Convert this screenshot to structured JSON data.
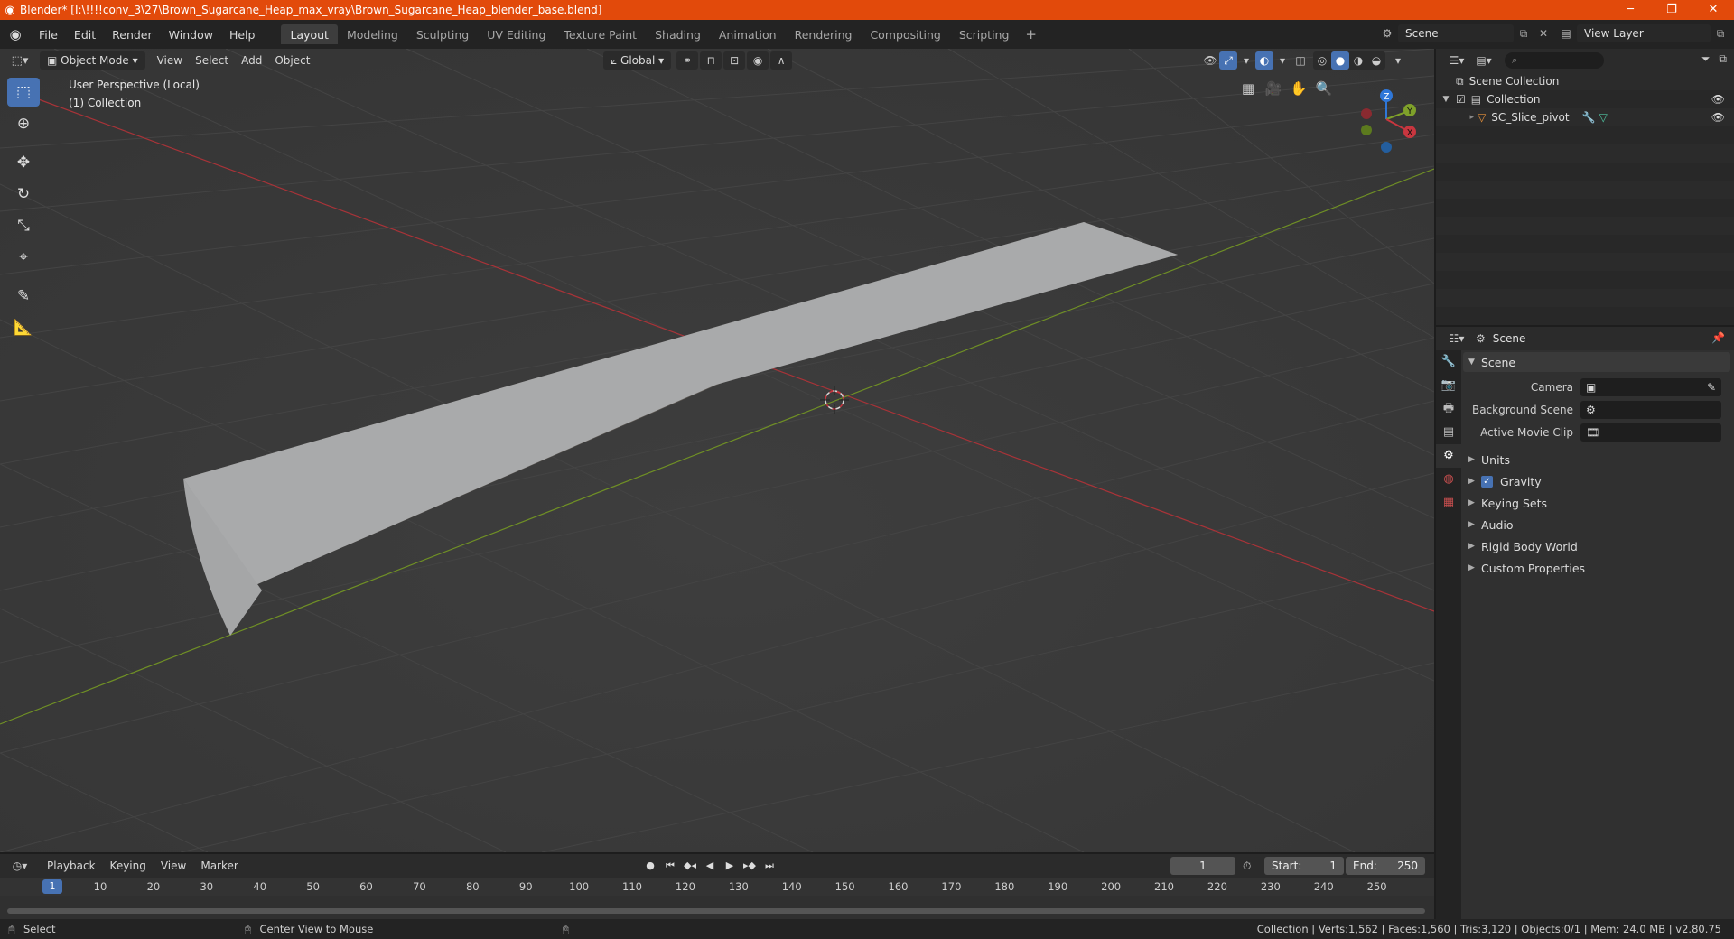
{
  "window": {
    "title": "Blender* [I:\\!!!!conv_3\\27\\Brown_Sugarcane_Heap_max_vray\\Brown_Sugarcane_Heap_blender_base.blend]",
    "minimize_icon": "─",
    "maximize_icon": "❐",
    "close_icon": "✕"
  },
  "menubar": {
    "items": [
      "File",
      "Edit",
      "Render",
      "Window",
      "Help"
    ],
    "workspaces": [
      "Layout",
      "Modeling",
      "Sculpting",
      "UV Editing",
      "Texture Paint",
      "Shading",
      "Animation",
      "Rendering",
      "Compositing",
      "Scripting"
    ],
    "active_workspace": "Layout",
    "add_tab": "+",
    "scene": "Scene",
    "view_layer": "View Layer"
  },
  "viewport": {
    "mode": "Object Mode",
    "menus": [
      "View",
      "Select",
      "Add",
      "Object"
    ],
    "orientation": "Global",
    "info_line1": "User Perspective (Local)",
    "info_line2": "(1) Collection",
    "gizmo_labels": {
      "z": "Z",
      "y": "Y",
      "x": "X"
    }
  },
  "outliner": {
    "search_placeholder": "",
    "rows": [
      {
        "label": "Scene Collection"
      },
      {
        "label": "Collection"
      },
      {
        "label": "SC_Slice_pivot"
      }
    ]
  },
  "properties": {
    "context": "Scene",
    "panel_title": "Scene",
    "fields": [
      {
        "label": "Camera",
        "value": ""
      },
      {
        "label": "Background Scene",
        "value": ""
      },
      {
        "label": "Active Movie Clip",
        "value": ""
      }
    ],
    "subpanels": [
      "Units",
      "Gravity",
      "Keying Sets",
      "Audio",
      "Rigid Body World",
      "Custom Properties"
    ]
  },
  "timeline": {
    "menus": [
      "Playback",
      "Keying",
      "View",
      "Marker"
    ],
    "current_frame": "1",
    "start_label": "Start:",
    "start_value": "1",
    "end_label": "End:",
    "end_value": "250",
    "ruler_ticks": [
      "1",
      "10",
      "20",
      "30",
      "40",
      "50",
      "60",
      "70",
      "80",
      "90",
      "100",
      "110",
      "120",
      "130",
      "140",
      "150",
      "160",
      "170",
      "180",
      "190",
      "200",
      "210",
      "220",
      "230",
      "240",
      "250"
    ]
  },
  "statusbar": {
    "select": "Select",
    "center_view": "Center View to Mouse",
    "stats": "Collection | Verts:1,562 | Faces:1,560 | Tris:3,120 | Objects:0/1 | Mem: 24.0 MB | v2.80.75"
  },
  "colors": {
    "title_bar": "#e24a0b",
    "accent": "#4772b3",
    "x_axis": "#c8363f",
    "y_axis": "#7fa12a",
    "z_axis": "#2f77d8"
  }
}
